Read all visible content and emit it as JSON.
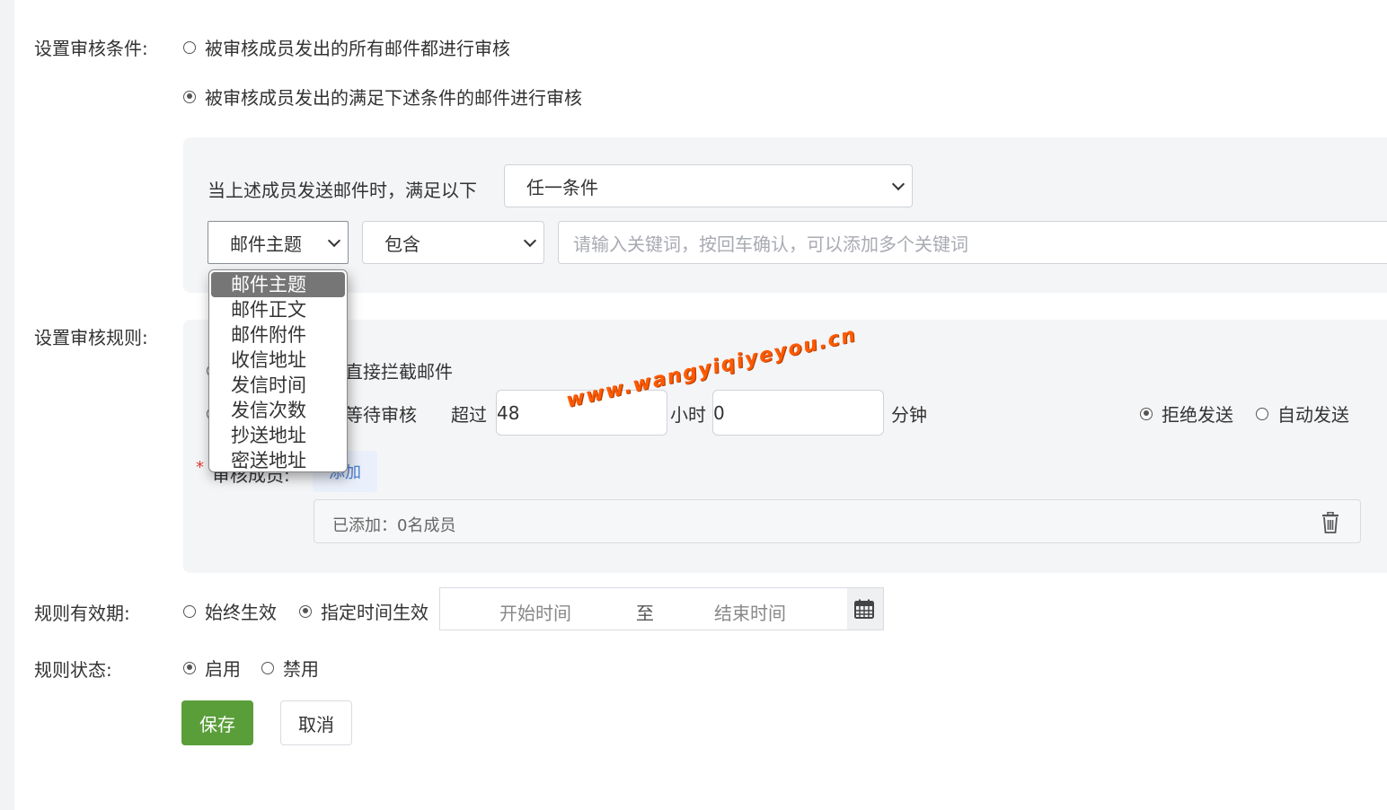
{
  "audit_condition": {
    "label": "设置审核条件:",
    "options": [
      {
        "label": "被审核成员发出的所有邮件都进行审核",
        "selected": false
      },
      {
        "label": "被审核成员发出的满足下述条件的邮件进行审核",
        "selected": true
      }
    ],
    "match_prefix": "当上述成员发送邮件时，满足以下",
    "match_mode": "任一条件",
    "field_select": "邮件主题",
    "operator_select": "包含",
    "keyword_placeholder": "请输入关键词，按回车确认，可以添加多个关键词"
  },
  "field_dropdown": {
    "items": [
      "邮件主题",
      "邮件正文",
      "邮件附件",
      "收信地址",
      "发信时间",
      "发信次数",
      "抄送地址",
      "密送地址"
    ],
    "selected_index": 0
  },
  "audit_rule": {
    "label": "设置审核规则:",
    "option_block": "直接拦截邮件",
    "option_wait": "等待审核",
    "exceed": "超过",
    "hours_value": "48",
    "hours_unit": "小时",
    "minutes_value": "0",
    "minutes_unit": "分钟",
    "after_options": [
      {
        "label": "拒绝发送",
        "selected": true
      },
      {
        "label": "自动发送",
        "selected": false
      }
    ],
    "reviewer_required": "*",
    "reviewer_label": "审核成员:",
    "add_button": "添加",
    "added_summary": "已添加：0名成员"
  },
  "validity": {
    "label": "规则有效期:",
    "options": [
      {
        "label": "始终生效",
        "selected": false
      },
      {
        "label": "指定时间生效",
        "selected": true
      }
    ],
    "start_placeholder": "开始时间",
    "separator": "至",
    "end_placeholder": "结束时间"
  },
  "status": {
    "label": "规则状态:",
    "options": [
      {
        "label": "启用",
        "selected": true
      },
      {
        "label": "禁用",
        "selected": false
      }
    ]
  },
  "actions": {
    "save": "保存",
    "cancel": "取消"
  },
  "watermark": "www.wangyiqiyeyou.cn",
  "colors": {
    "primary_green": "#5a9e3a",
    "required_red": "#e53935",
    "watermark_orange": "#ff5a00"
  }
}
